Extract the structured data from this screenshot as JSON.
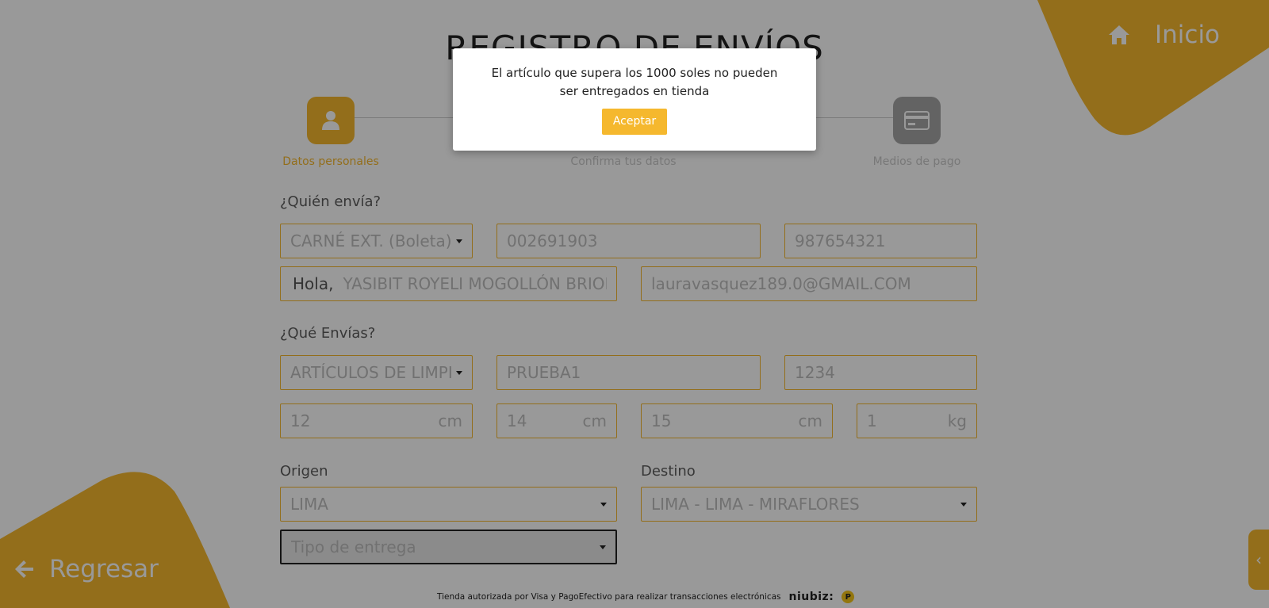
{
  "header": {
    "title": "REGISTRO DE ENVÍOS",
    "home_label": "Inicio"
  },
  "nav": {
    "back_label": "Regresar"
  },
  "stepper": {
    "steps": [
      {
        "label": "Datos personales",
        "icon": "user-icon",
        "active": true
      },
      {
        "label": "Confirma tus datos",
        "icon": "check-icon",
        "active": false
      },
      {
        "label": "Medios de pago",
        "icon": "credit-card-icon",
        "active": false
      }
    ]
  },
  "sender": {
    "section_label": "¿Quién envía?",
    "doc_type": "CARNÉ EXT. (Boleta)",
    "doc_number": "002691903",
    "phone": "987654321",
    "greeting": "Hola,",
    "name": "YASIBIT ROYELI MOGOLLÓN BRIONES",
    "email": "lauravasquez189.0@GMAIL.COM"
  },
  "shipment": {
    "section_label": "¿Qué Envías?",
    "category": "ARTÍCULOS DE LIMPIEZA",
    "description": "PRUEBA1",
    "value": "1234",
    "length": "12",
    "length_unit": "cm",
    "width": "14",
    "width_unit": "cm",
    "height": "15",
    "height_unit": "cm",
    "weight": "1",
    "weight_unit": "kg"
  },
  "route": {
    "origin_label": "Origen",
    "origin": "LIMA",
    "destination_label": "Destino",
    "destination": "LIMA - LIMA - MIRAFLORES",
    "delivery_placeholder": "Tipo de entrega"
  },
  "footer": {
    "text": "Tienda autorizada por Visa y PagoEfectivo para realizar transacciones electrónicas",
    "niubiz": "niubiz:",
    "pe_logo": "P"
  },
  "modal": {
    "message": "El artículo que supera los 1000 soles no pueden ser entregados en tienda",
    "button_label": "Aceptar"
  },
  "colors": {
    "accent": "#f5b82e",
    "inactive": "#a6a6a6"
  }
}
